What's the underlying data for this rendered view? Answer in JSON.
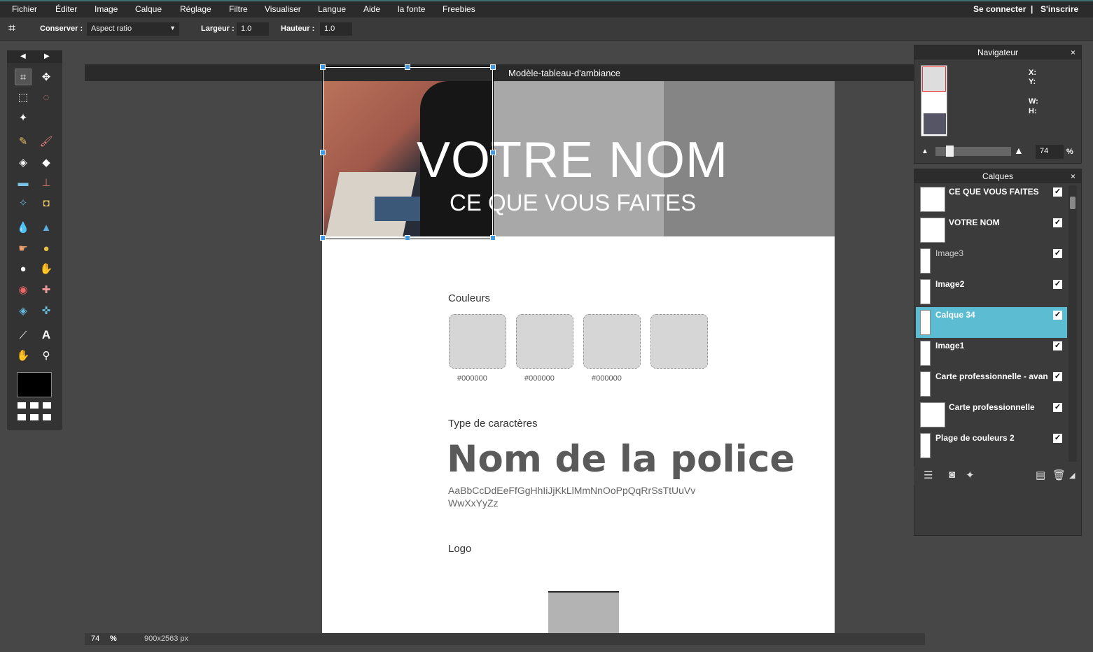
{
  "menu": {
    "items": [
      "Fichier",
      "Éditer",
      "Image",
      "Calque",
      "Réglage",
      "Filtre",
      "Visualiser",
      "Langue",
      "Aide",
      "la fonte",
      "Freebies"
    ],
    "login": "Se connecter",
    "separator": "|",
    "signup": "S'inscrire"
  },
  "options": {
    "keep_label": "Conserver :",
    "keep_value": "Aspect ratio",
    "width_label": "Largeur :",
    "width_value": "1.0",
    "height_label": "Hauteur :",
    "height_value": "1.0"
  },
  "document": {
    "title": "Modèle-tableau-d'ambiance",
    "hero_name": "VOTRE NOM",
    "hero_sub": "CE QUE VOUS FAITES",
    "colors_title": "Couleurs",
    "swatch_hex": [
      "#000000",
      "#000000",
      "#000000"
    ],
    "font_title": "Type de caractères",
    "font_name": "Nom de la police",
    "alphabet": "AaBbCcDdEeFfGgHhIiJjKkLlMmNnOoPpQqRrSsTtUuVv WwXxYyZz",
    "logo_title": "Logo"
  },
  "status": {
    "zoom": "74",
    "zoom_unit": "%",
    "size": "900x2563 px"
  },
  "navigator": {
    "title": "Navigateur",
    "close": "×",
    "x_label": "X:",
    "y_label": "Y:",
    "w_label": "W:",
    "h_label": "H:",
    "zoom": "74",
    "zoom_unit": "%"
  },
  "layers": {
    "title": "Calques",
    "close": "×",
    "items": [
      {
        "name": "CE QUE VOUS FAITES",
        "visible": true
      },
      {
        "name": "VOTRE NOM",
        "visible": true
      },
      {
        "name": "Image3",
        "visible": true
      },
      {
        "name": "Image2",
        "visible": true
      },
      {
        "name": "Calque 34",
        "visible": true,
        "active": true
      },
      {
        "name": "Image1",
        "visible": true
      },
      {
        "name": "Carte professionnelle - avan",
        "visible": true
      },
      {
        "name": "Carte professionnelle",
        "visible": true
      },
      {
        "name": "Plage de couleurs 2",
        "visible": true
      }
    ]
  },
  "colors": {
    "accent": "#3e9ae8",
    "active_layer": "#5bbcd2",
    "foreground": "#000000"
  }
}
